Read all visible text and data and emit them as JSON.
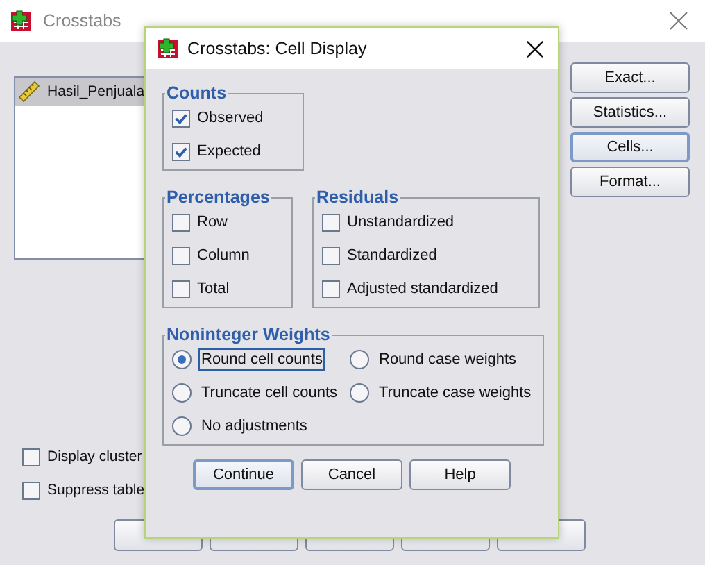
{
  "window": {
    "title": "Crosstabs"
  },
  "variables": [
    {
      "label": "Hasil_Penjuala",
      "selected": true
    }
  ],
  "side_buttons": [
    {
      "label": "Exact...",
      "selected": false
    },
    {
      "label": "Statistics...",
      "selected": false
    },
    {
      "label": "Cells...",
      "selected": true
    },
    {
      "label": "Format...",
      "selected": false
    }
  ],
  "options": [
    {
      "label": "Display cluster",
      "checked": false
    },
    {
      "label": "Suppress table",
      "checked": false
    }
  ],
  "bottom_buttons": [
    {
      "kind": "button"
    },
    {
      "kind": "button"
    },
    {
      "kind": "button"
    },
    {
      "kind": "button"
    },
    {
      "kind": "button"
    }
  ],
  "dialog": {
    "title": "Crosstabs: Cell Display",
    "counts": {
      "title": "Counts",
      "items": [
        {
          "label": "Observed",
          "checked": true
        },
        {
          "label": "Expected",
          "checked": true
        }
      ]
    },
    "percentages": {
      "title": "Percentages",
      "items": [
        {
          "label": "Row",
          "checked": false
        },
        {
          "label": "Column",
          "checked": false
        },
        {
          "label": "Total",
          "checked": false
        }
      ]
    },
    "residuals": {
      "title": "Residuals",
      "items": [
        {
          "label": "Unstandardized",
          "checked": false
        },
        {
          "label": "Standardized",
          "checked": false
        },
        {
          "label": "Adjusted standardized",
          "checked": false
        }
      ]
    },
    "weights": {
      "title": "Noninteger Weights",
      "options": [
        {
          "label": "Round cell counts",
          "selected": true,
          "focused": true
        },
        {
          "label": "Round case weights",
          "selected": false,
          "focused": false
        },
        {
          "label": "Truncate cell counts",
          "selected": false,
          "focused": false
        },
        {
          "label": "Truncate case weights",
          "selected": false,
          "focused": false
        },
        {
          "label": "No adjustments",
          "selected": false,
          "focused": false
        }
      ]
    },
    "buttons": [
      {
        "label": "Continue",
        "selected": true
      },
      {
        "label": "Cancel",
        "selected": false
      },
      {
        "label": "Help",
        "selected": false
      }
    ]
  }
}
